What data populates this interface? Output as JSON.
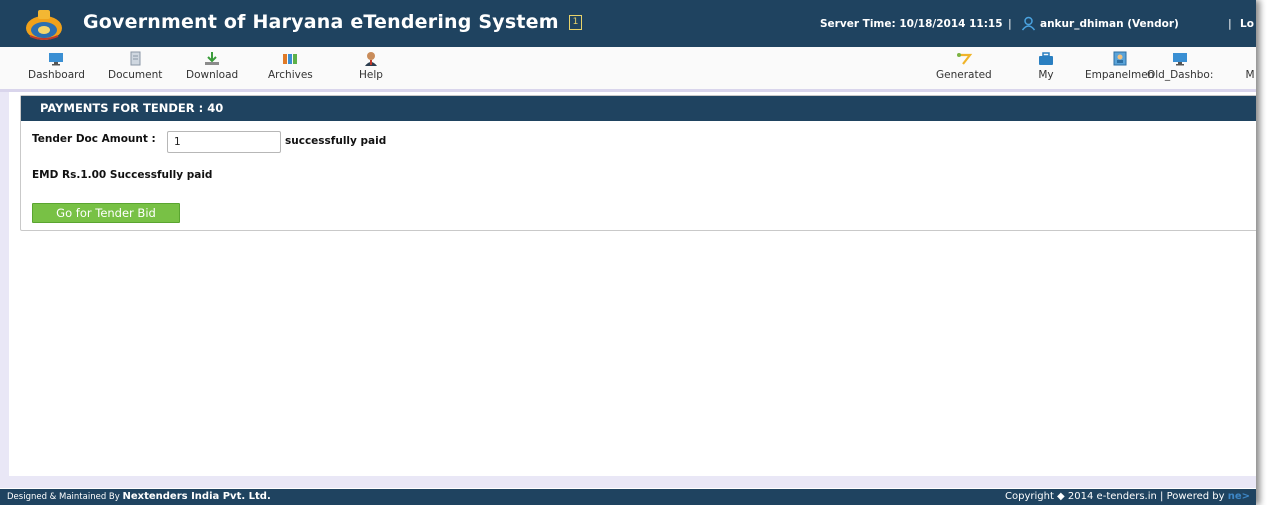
{
  "header": {
    "title": "Government of Haryana eTendering System",
    "badge": "1",
    "server_time": "Server Time: 10/18/2014 11:15",
    "separator": "|",
    "user": "ankur_dhiman (Vendor)",
    "logout": "Lo"
  },
  "toolbar": {
    "items": [
      {
        "label": "Dashboard",
        "icon": "monitor-icon"
      },
      {
        "label": "Document",
        "icon": "document-icon"
      },
      {
        "label": "Download",
        "icon": "download-icon"
      },
      {
        "label": "Archives",
        "icon": "archives-icon"
      },
      {
        "label": "Help",
        "icon": "help-icon"
      },
      {
        "label": "Generated",
        "icon": "generated-icon"
      },
      {
        "label": "My",
        "icon": "briefcase-icon"
      },
      {
        "label": "Empanelmen",
        "icon": "contact-card-icon"
      },
      {
        "label": "Old_Dashbo:",
        "icon": "monitor-icon"
      },
      {
        "label": "M",
        "icon": ""
      }
    ]
  },
  "panel": {
    "title": "PAYMENTS FOR TENDER : 40",
    "tender_doc_label": "Tender Doc Amount :",
    "tender_doc_value": "1",
    "tender_doc_status": "successfully paid",
    "emd_status": "EMD Rs.1.00 Successfully paid",
    "bid_button": "Go for Tender Bid"
  },
  "footer": {
    "designed_by": "Designed & Maintained By",
    "company": "Nextenders India Pvt. Ltd.",
    "copyright": "Copyright ◆ 2014 e-tenders.in | Powered by",
    "powered_brand": "ne>"
  },
  "colors": {
    "header_bg": "#1f4360",
    "button_green": "#78c145",
    "content_bg": "#e9e7f6"
  }
}
